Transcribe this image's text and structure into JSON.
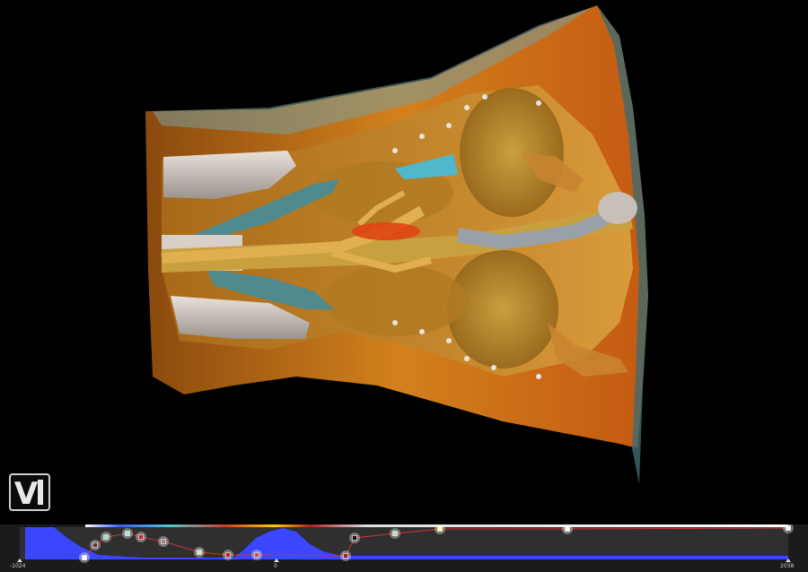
{
  "logo": {
    "letter": "V"
  },
  "transfer_function": {
    "axis": {
      "min_label": "-1024",
      "zero_label": "0",
      "max_label": "2038"
    },
    "histogram_color": "#3a46ff",
    "line_color": "#d23030",
    "control_point_colors": [
      "#ffffff",
      "#7a2a2a",
      "#9be0c0",
      "#99eedd",
      "#cc2222",
      "#a08080",
      "#d9d9d9",
      "#c02020",
      "#d24a2a",
      "#a02020",
      "#111111",
      "#b8e0b8",
      "#ffffa8",
      "#ffffff",
      "#ffffff"
    ]
  }
}
